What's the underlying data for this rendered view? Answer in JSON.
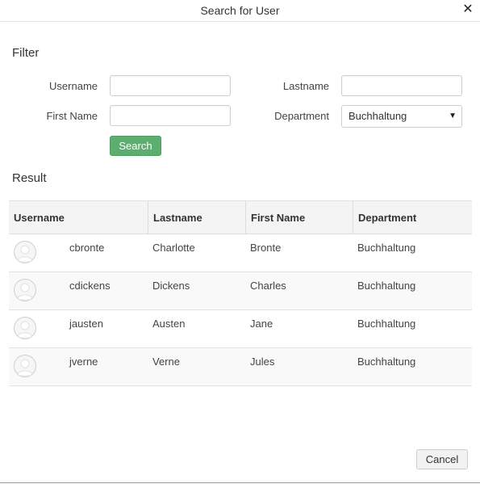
{
  "dialog": {
    "title": "Search for User",
    "close_glyph": "✕"
  },
  "filter": {
    "heading": "Filter",
    "username_label": "Username",
    "username_value": "",
    "lastname_label": "Lastname",
    "lastname_value": "",
    "firstname_label": "First Name",
    "firstname_value": "",
    "department_label": "Department",
    "department_selected": "Buchhaltung",
    "dropdown_glyph": "▼",
    "search_label": "Search"
  },
  "result": {
    "heading": "Result",
    "columns": [
      "Username",
      "Lastname",
      "First Name",
      "Department"
    ],
    "rows": [
      {
        "username": "cbronte",
        "lastname": "Charlotte",
        "firstname": "Bronte",
        "department": "Buchhaltung"
      },
      {
        "username": "cdickens",
        "lastname": "Dickens",
        "firstname": "Charles",
        "department": "Buchhaltung"
      },
      {
        "username": "jausten",
        "lastname": "Austen",
        "firstname": "Jane",
        "department": "Buchhaltung"
      },
      {
        "username": "jverne",
        "lastname": "Verne",
        "firstname": "Jules",
        "department": "Buchhaltung"
      }
    ]
  },
  "footer": {
    "cancel_label": "Cancel"
  }
}
